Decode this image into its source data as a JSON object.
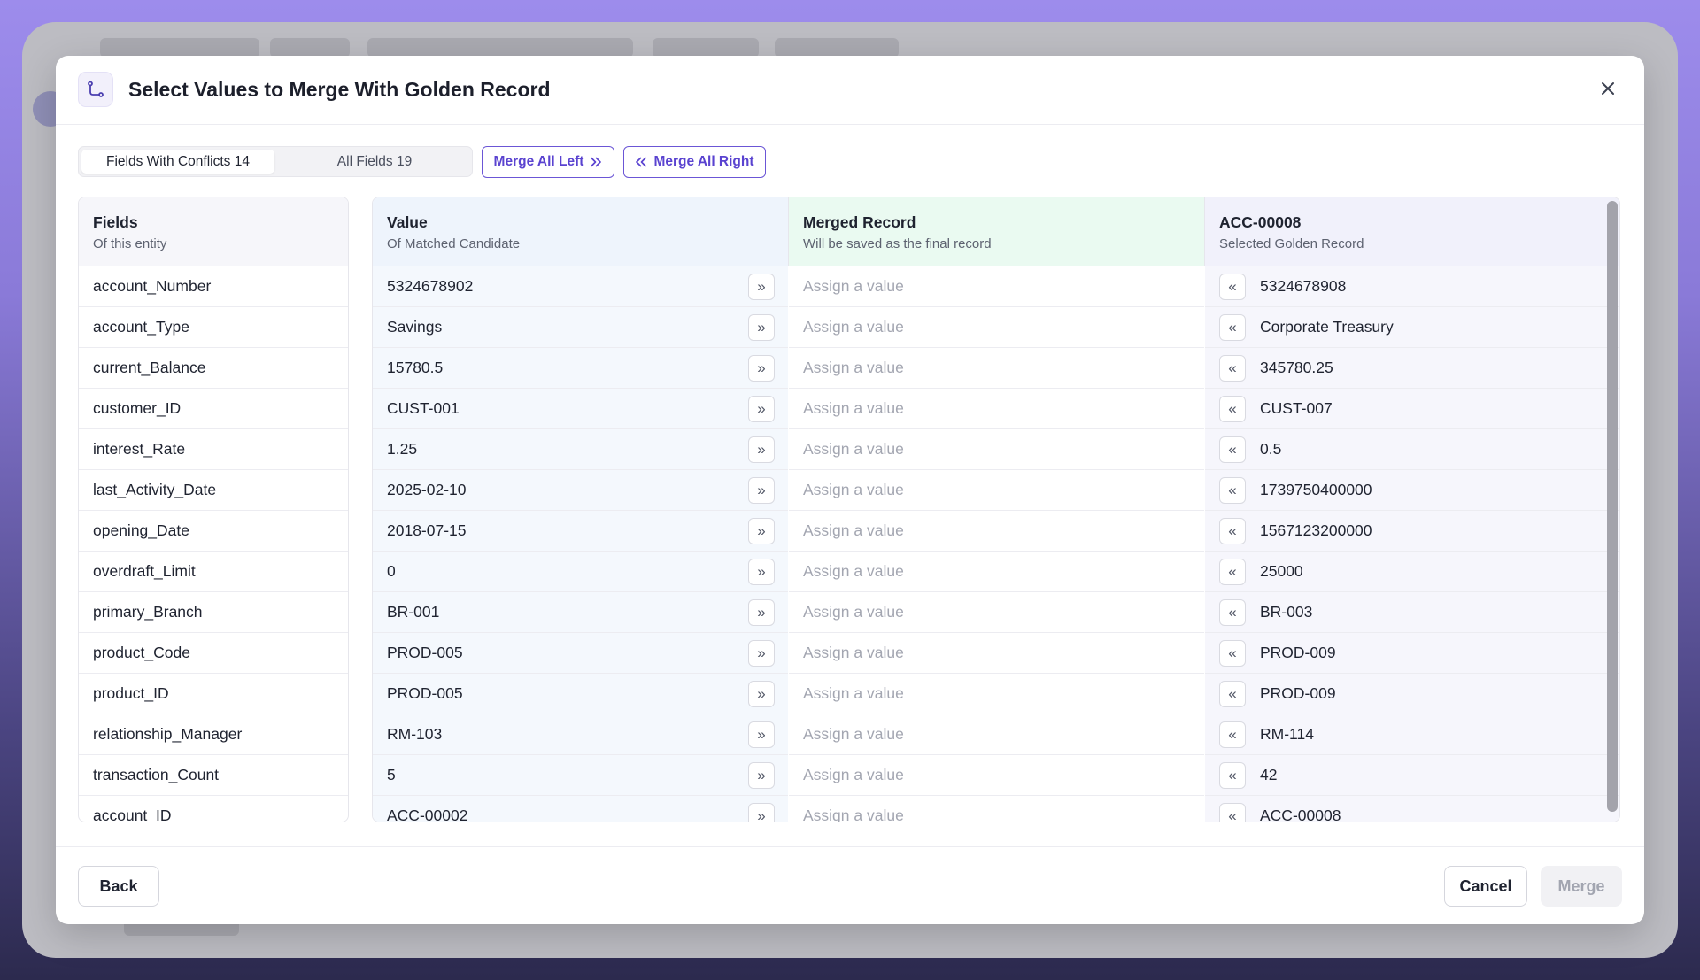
{
  "dialog": {
    "title": "Select Values to Merge With Golden Record",
    "icon": "merge-branch-icon",
    "close_icon": "close-icon"
  },
  "tabs": [
    {
      "label": "Fields With Conflicts 14",
      "active": true
    },
    {
      "label": "All Fields 19",
      "active": false
    }
  ],
  "actions": {
    "merge_all_left": "Merge All Left",
    "merge_all_right": "Merge All Right"
  },
  "columns": {
    "fields": {
      "title": "Fields",
      "subtitle": "Of this entity"
    },
    "value": {
      "title": "Value",
      "subtitle": "Of Matched Candidate"
    },
    "merged": {
      "title": "Merged Record",
      "subtitle": "Will be saved as the final record"
    },
    "golden": {
      "title": "ACC-00008",
      "subtitle": "Selected Golden Record"
    }
  },
  "placeholder": "Assign a value",
  "rows": [
    {
      "field": "account_Number",
      "value": "5324678902",
      "golden": "5324678908"
    },
    {
      "field": "account_Type",
      "value": "Savings",
      "golden": "Corporate Treasury"
    },
    {
      "field": "current_Balance",
      "value": "15780.5",
      "golden": "345780.25"
    },
    {
      "field": "customer_ID",
      "value": "CUST-001",
      "golden": "CUST-007"
    },
    {
      "field": "interest_Rate",
      "value": "1.25",
      "golden": "0.5"
    },
    {
      "field": "last_Activity_Date",
      "value": "2025-02-10",
      "golden": "1739750400000"
    },
    {
      "field": "opening_Date",
      "value": "2018-07-15",
      "golden": "1567123200000"
    },
    {
      "field": "overdraft_Limit",
      "value": "0",
      "golden": "25000"
    },
    {
      "field": "primary_Branch",
      "value": "BR-001",
      "golden": "BR-003"
    },
    {
      "field": "product_Code",
      "value": "PROD-005",
      "golden": "PROD-009"
    },
    {
      "field": "product_ID",
      "value": "PROD-005",
      "golden": "PROD-009"
    },
    {
      "field": "relationship_Manager",
      "value": "RM-103",
      "golden": "RM-114"
    },
    {
      "field": "transaction_Count",
      "value": "5",
      "golden": "42"
    },
    {
      "field": "account_ID",
      "value": "ACC-00002",
      "golden": "ACC-00008"
    }
  ],
  "footer": {
    "back": "Back",
    "cancel": "Cancel",
    "merge": "Merge"
  },
  "colors": {
    "accent": "#5a43d0",
    "value_bg": "#f4f8fd",
    "merged_header_bg": "#eafaf1",
    "golden_bg": "#f6f6fc"
  }
}
